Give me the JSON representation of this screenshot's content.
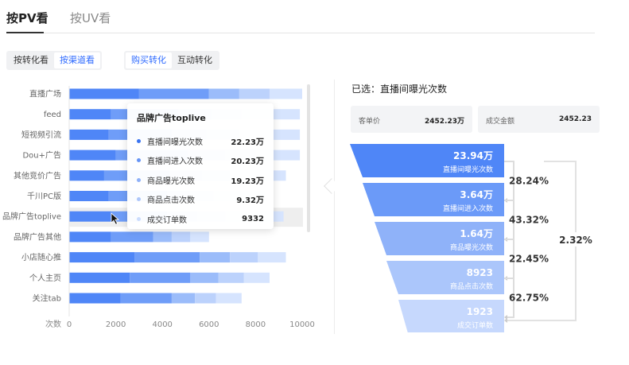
{
  "top_tabs": [
    {
      "label": "按PV看",
      "active": true
    },
    {
      "label": "按UV看",
      "active": false
    }
  ],
  "view_toggle": [
    "按转化看",
    "按渠道看"
  ],
  "view_selected": 1,
  "type_toggle": [
    "购买转化",
    "互动转化"
  ],
  "type_selected": 0,
  "chart_data": {
    "type": "bar",
    "orientation": "horizontal",
    "stacked": true,
    "categories": [
      "直播广场",
      "feed",
      "短视频引流",
      "Dou+广告",
      "其他竞价广告",
      "千川PC版",
      "品牌广告toplive",
      "品牌广告其他",
      "小店随心推",
      "个人主页",
      "关注tab"
    ],
    "series": [
      {
        "name": "成交订单数",
        "values": [
          0,
          0,
          0,
          0,
          0,
          0,
          9332,
          0,
          0,
          0,
          0
        ]
      },
      {
        "name": "直播间曝光次数",
        "values": [
          3000,
          1800,
          1700,
          2000,
          1500,
          1700,
          1800,
          1800,
          2800,
          2600,
          2200
        ]
      },
      {
        "name": "直播间进入次数",
        "values": [
          3000,
          2900,
          2700,
          3100,
          2800,
          2500,
          2400,
          1800,
          2800,
          2600,
          2200
        ]
      },
      {
        "name": "商品曝光次数",
        "values": [
          1300,
          1400,
          1500,
          1600,
          1400,
          1000,
          1300,
          800,
          1300,
          1200,
          1000
        ]
      },
      {
        "name": "商品点击次数",
        "values": [
          1300,
          1300,
          1400,
          1300,
          1200,
          1000,
          1200,
          800,
          1200,
          1100,
          900
        ]
      },
      {
        "name": "成交订单数 ",
        "values": [
          1400,
          2500,
          2600,
          1900,
          2400,
          2200,
          2500,
          800,
          1200,
          1100,
          1100
        ]
      }
    ],
    "xlabel": "次数",
    "xticks": [
      0,
      2000,
      4000,
      6000,
      8000,
      10000
    ],
    "xlim": [
      0,
      10000
    ],
    "highlight_category": "品牌广告toplive",
    "colors": [
      "#4f86f7",
      "#6f9df8",
      "#9bbcfa",
      "#bcd2fc",
      "#d6e4fe"
    ]
  },
  "tooltip": {
    "title": "品牌广告toplive",
    "rows": [
      {
        "name": "直播间曝光次数",
        "value": "22.23万",
        "color": "#3a74f0"
      },
      {
        "name": "直播间进入次数",
        "value": "20.23万",
        "color": "#6694f5"
      },
      {
        "name": "商品曝光次数",
        "value": "19.23万",
        "color": "#8fb1f8"
      },
      {
        "name": "商品点击次数",
        "value": "9.32万",
        "color": "#adc6fa"
      },
      {
        "name": "成交订单数",
        "value": "9332",
        "color": "#cbdcfd"
      }
    ]
  },
  "selected_prefix": "已选：",
  "selected_value": "直播间曝光次数",
  "metrics": [
    {
      "name": "客单价",
      "value": "2452.23万"
    },
    {
      "name": "成交金额",
      "value": "2452.23"
    }
  ],
  "funnel": {
    "stages": [
      {
        "value": "23.94万",
        "label": "直播间曝光次数",
        "color": "#4f86f7"
      },
      {
        "value": "3.64万",
        "label": "直播间进入次数",
        "color": "#6b9af8"
      },
      {
        "value": "1.64万",
        "label": "商品曝光次数",
        "color": "#8fb2f9"
      },
      {
        "value": "8923",
        "label": "商品点击次数",
        "color": "#abc6fb"
      },
      {
        "value": "1923",
        "label": "成交订单数",
        "color": "#c6d8fd"
      }
    ],
    "step_rates": [
      "28.24%",
      "43.32%",
      "22.45%",
      "62.75%"
    ],
    "overall_rate": "2.32%"
  }
}
